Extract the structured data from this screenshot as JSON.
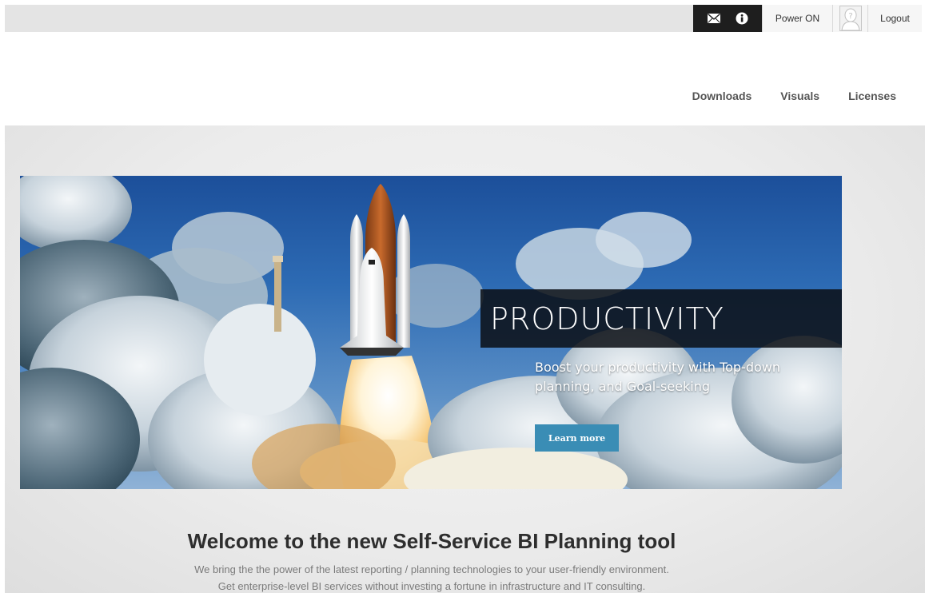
{
  "topbar": {
    "icons": [
      "mail-icon",
      "info-icon"
    ],
    "power_label": "Power ON",
    "avatar_icon": "user-avatar-placeholder",
    "logout_label": "Logout"
  },
  "nav": {
    "items": [
      {
        "label": "Downloads"
      },
      {
        "label": "Visuals"
      },
      {
        "label": "Licenses"
      }
    ]
  },
  "hero": {
    "headline": "PRODUCTIVITY",
    "subtext": "Boost your productivity with Top-down planning, and Goal-seeking",
    "cta_label": "Learn more",
    "image": "space-shuttle-launch"
  },
  "welcome": {
    "title": "Welcome to the new Self-Service BI Planning tool",
    "line1": "We bring the the power of the latest reporting / planning technologies to your user-friendly environment.",
    "line2": "Get enterprise-level BI services without investing a fortune in infrastructure and IT consulting."
  },
  "colors": {
    "topbar_bg": "#e4e4e4",
    "icon_box_bg": "#1e1e1e",
    "cta_bg": "#3a8db5",
    "headline_bg": "#0a0e14"
  }
}
